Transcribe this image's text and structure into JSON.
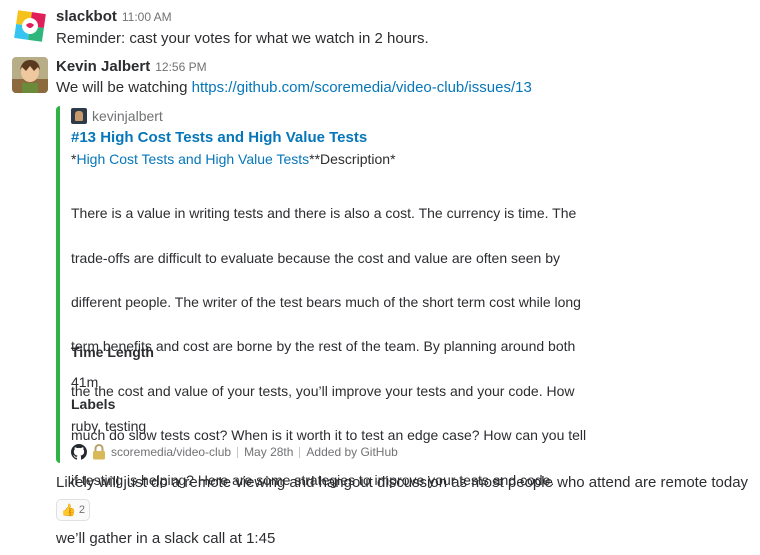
{
  "messages": [
    {
      "author": "slackbot",
      "time": "11:00 AM",
      "text": "Reminder: cast your votes for what we watch in 2 hours."
    },
    {
      "author": "Kevin Jalbert",
      "time": "12:56 PM",
      "text_prefix": "We will be watching ",
      "link": "https://github.com/scoremedia/video-club/issues/13",
      "attachment": {
        "author": "kevinjalbert",
        "title": "#13 High Cost Tests and High Value Tests",
        "subtitle_star_left": "*",
        "subtitle_link": "High Cost Tests and High Value Tests",
        "subtitle_rest": "**Description*",
        "description_lines": [
          "There is a value in writing tests and there is also a cost. The currency is time. The",
          "trade-offs are difficult to evaluate because the cost and value are often seen by",
          "different people. The writer of the test bears much of the short term cost while long",
          "term benefits and cost are borne by the rest of the team. By planning around both",
          "the the cost and value of your tests, you’ll improve your tests and your code. How",
          "much do slow tests cost? When is it worth it to test an edge case? How can you tell",
          "if testing is helping? Here are some strategies to improve your tests and code."
        ],
        "fields": [
          {
            "title": "Time Length",
            "value": "41m"
          },
          {
            "title": "Labels",
            "value": "ruby, testing"
          }
        ],
        "footer": {
          "repo": "scoremedia/video-club",
          "date": "May 28th",
          "added_by": "Added by GitHub"
        },
        "accent_color": "#2fb344"
      },
      "follow_up": "Likely will just do a remote viewing and hangout discussion as most people who attend are remote today",
      "reaction": {
        "emoji": "👍",
        "count": "2"
      },
      "last": "we’ll gather in a slack call at 1:45"
    }
  ],
  "colors": {
    "link": "#0576b9",
    "text": "#2c2d30",
    "muted": "#717274"
  },
  "icons": [
    "slackbot-avatar",
    "kevin-avatar",
    "github-icon",
    "lock-icon",
    "thumbs-up-icon"
  ]
}
